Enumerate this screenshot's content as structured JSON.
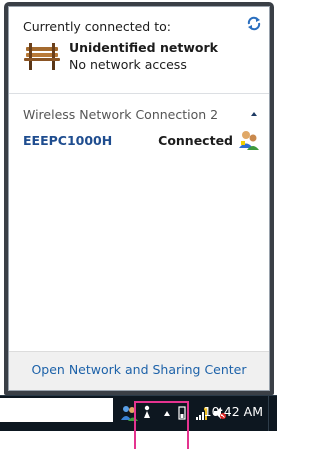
{
  "flyout": {
    "connected_to_label": "Currently connected to:",
    "network": {
      "name": "Unidentified network",
      "status": "No network access"
    },
    "wireless_section": {
      "header": "Wireless Network Connection 2",
      "connection": {
        "name": "EEEPC1000H",
        "state": "Connected"
      }
    },
    "footer_link": "Open Network and Sharing Center"
  },
  "taskbar": {
    "clock": "10:42 AM"
  },
  "colors": {
    "link": "#1d62a9",
    "wifi_name": "#1f4d8f",
    "highlight": "#e4338f"
  }
}
